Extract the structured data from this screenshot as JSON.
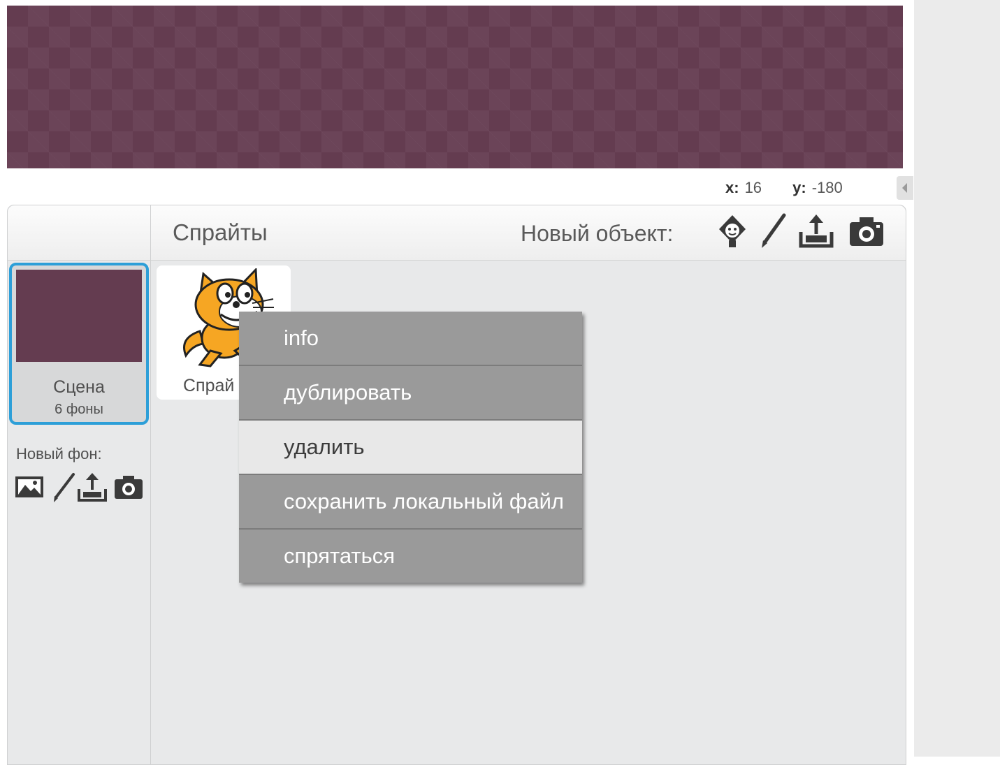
{
  "stage": {
    "background_color": "#643c50"
  },
  "coords": {
    "x_label": "x:",
    "x_value": "16",
    "y_label": "y:",
    "y_value": "-180"
  },
  "sprites_panel": {
    "title": "Спрайты",
    "new_object_label": "Новый объект:",
    "new_object_icons": [
      "choose-sprite-from-library-icon",
      "paint-new-sprite-icon",
      "upload-sprite-icon",
      "camera-icon"
    ]
  },
  "scene": {
    "name": "Сцена",
    "subtitle": "6 фоны"
  },
  "new_backdrop": {
    "label": "Новый фон:",
    "icons": [
      "choose-backdrop-from-library-icon",
      "paint-backdrop-icon",
      "upload-backdrop-icon",
      "camera-icon"
    ]
  },
  "sprite": {
    "label": "Спрай",
    "selection_color": "#2d9fd8"
  },
  "context_menu": {
    "items": [
      "info",
      "дублировать",
      "удалить",
      "сохранить локальный файл",
      "спрятаться"
    ],
    "hovered_item": "удалить"
  }
}
